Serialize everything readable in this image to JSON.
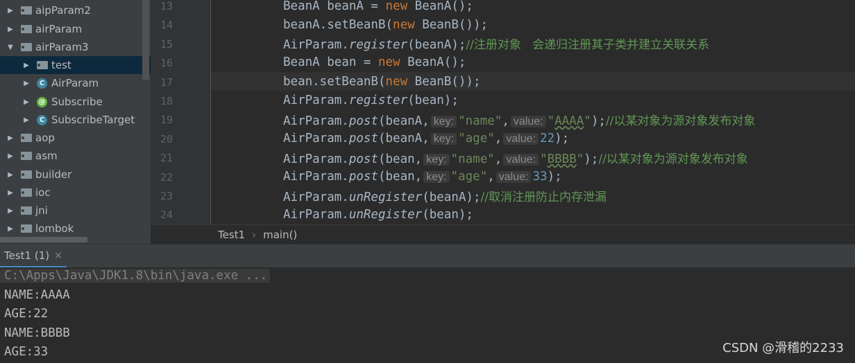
{
  "project_tree": {
    "items": [
      {
        "label": "aipParam2",
        "kind": "folder",
        "expanded": false
      },
      {
        "label": "airParam",
        "kind": "folder",
        "expanded": false
      },
      {
        "label": "airParam3",
        "kind": "folder",
        "expanded": true
      },
      {
        "label": "test",
        "kind": "folder",
        "expanded": false,
        "selected": true
      },
      {
        "label": "AirParam",
        "kind": "class",
        "icon_letter": "C"
      },
      {
        "label": "Subscribe",
        "kind": "annotation",
        "icon_letter": "@"
      },
      {
        "label": "SubscribeTarget",
        "kind": "class",
        "icon_letter": "C"
      },
      {
        "label": "aop",
        "kind": "folder",
        "expanded": false
      },
      {
        "label": "asm",
        "kind": "folder",
        "expanded": false
      },
      {
        "label": "builder",
        "kind": "folder",
        "expanded": false
      },
      {
        "label": "ioc",
        "kind": "folder",
        "expanded": false
      },
      {
        "label": "jni",
        "kind": "folder",
        "expanded": false
      },
      {
        "label": "lombok",
        "kind": "folder",
        "expanded": false
      }
    ]
  },
  "editor": {
    "line_numbers": [
      "13",
      "14",
      "15",
      "16",
      "17",
      "18",
      "19",
      "20",
      "21",
      "22",
      "23",
      "24"
    ],
    "lines": {
      "l13": {
        "t1": "BeanA beanA = ",
        "kw": "new",
        "t2": " BeanA();"
      },
      "l14": {
        "t1": "beanA.setBeanB(",
        "kw": "new",
        "t2": " BeanB());"
      },
      "l15": {
        "cls": "AirParam.",
        "method": "register",
        "args": "(beanA);",
        "comment": "//注册对象   会递归注册其子类并建立关联关系"
      },
      "l16": {
        "t1": "BeanA bean = ",
        "kw": "new",
        "t2": " BeanA();"
      },
      "l17": {
        "t1": "bean.setBeanB(",
        "kw": "new",
        "t2": " BeanB());"
      },
      "l18": {
        "cls": "AirParam.",
        "method": "register",
        "args": "(bean);"
      },
      "l19": {
        "cls": "AirParam.",
        "method": "post",
        "open": "(beanA,",
        "key_hint": "key:",
        "key_val": "\"name\"",
        "comma": ",",
        "value_hint": "value:",
        "val_q1": "\"",
        "val": "AAAA",
        "val_q2": "\"",
        "close": ");",
        "comment": "//以某对象为源对象发布对象"
      },
      "l20": {
        "cls": "AirParam.",
        "method": "post",
        "open": "(beanA,",
        "key_hint": "key:",
        "key_val": "\"age\"",
        "comma": ",",
        "value_hint": "value:",
        "num": "22",
        "close": ");"
      },
      "l21": {
        "cls": "AirParam.",
        "method": "post",
        "open": "(bean,",
        "key_hint": "key:",
        "key_val": "\"name\"",
        "comma": ",",
        "value_hint": "value:",
        "val_q1": "\"",
        "val": "BBBB",
        "val_q2": "\"",
        "close": ");",
        "comment": "//以某对象为源对象发布对象"
      },
      "l22": {
        "cls": "AirParam.",
        "method": "post",
        "open": "(bean,",
        "key_hint": "key:",
        "key_val": "\"age\"",
        "comma": ",",
        "value_hint": "value:",
        "num": "33",
        "close": ");"
      },
      "l23": {
        "cls": "AirParam.",
        "method": "unRegister",
        "args": "(beanA);",
        "comment": "//取消注册防止内存泄漏"
      },
      "l24": {
        "cls": "AirParam.",
        "method": "unRegister",
        "args": "(bean);"
      }
    }
  },
  "breadcrumb": {
    "file": "Test1",
    "separator": "›",
    "method": "main()"
  },
  "run_panel": {
    "tab_label": "Test1 (1)",
    "close_glyph": "×",
    "console": [
      "C:\\Apps\\Java\\JDK1.8\\bin\\java.exe ...",
      "NAME:AAAA",
      "AGE:22",
      "NAME:BBBB",
      "AGE:33"
    ]
  },
  "watermark": "CSDN @滑稽的2233",
  "colors": {
    "keyword": "#cc7832",
    "string": "#6a8759",
    "comment": "#629755",
    "number": "#6897bb",
    "default": "#a9b7c6"
  }
}
